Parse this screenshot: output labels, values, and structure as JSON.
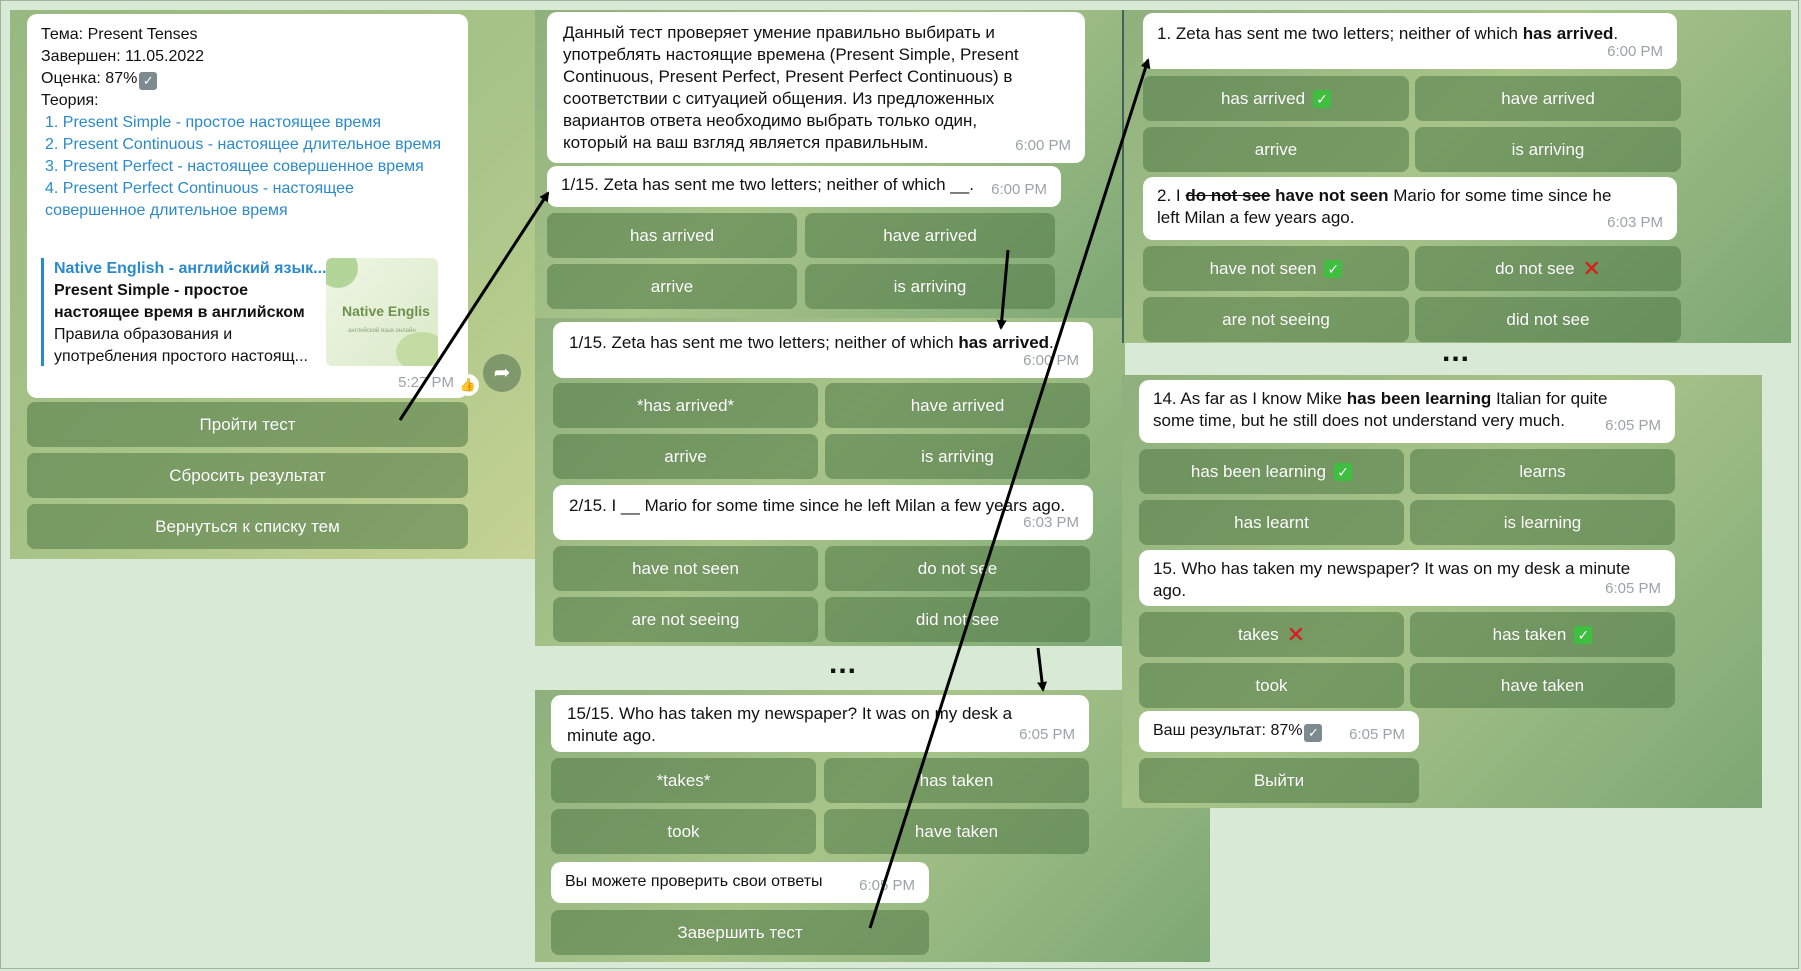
{
  "topic_card": {
    "topic": "Тема: Present Tenses",
    "completed": "Завершен: 11.05.2022",
    "grade": "Оценка: 87%",
    "theory_label": "Теория:",
    "theory_links": [
      "1. Present Simple - простое настоящее время",
      "2. Present Continuous - настоящее длительное время",
      "3. Present Perfect - настоящее совершенное время",
      "4. Present Perfect Continuous - настоящее совершенное длительное время"
    ],
    "preview": {
      "site": "Native English - английский язык...",
      "title": "Present Simple - простое настоящее время в английском",
      "desc": "Правила образования и употребления простого настоящ...",
      "thumb_text": "Native Englis",
      "thumb_sub": "английский язык онлайн"
    },
    "time": "5:27 PM",
    "buttons": [
      "Пройти тест",
      "Сбросить результат",
      "Вернуться к списку тем"
    ]
  },
  "intro": {
    "text": "Данный тест проверяет умение правильно выбирать и употреблять настоящие времена (Present Simple, Present Continuous, Present Perfect, Present Perfect Continuous) в соответствии с ситуацией общения. Из предложенных вариантов ответа необходимо выбрать только один, который на ваш взгляд является правильным.",
    "time": "6:00 PM"
  },
  "q1_unanswered": {
    "text": "1/15. Zeta has sent me two letters; neither of which __.",
    "time": "6:00 PM",
    "options": [
      "has arrived",
      "have arrived",
      "arrive",
      "is arriving"
    ]
  },
  "q1_answered": {
    "text_before": "1/15. Zeta has sent me two letters; neither of which ",
    "text_bold": "has arrived",
    "text_after": ".",
    "time": "6:00 PM",
    "options": [
      "*has arrived*",
      "have arrived",
      "arrive",
      "is arriving"
    ]
  },
  "q2_unanswered": {
    "text": "2/15. I __ Mario for some time since he left Milan a few years ago.",
    "time": "6:03 PM",
    "options": [
      "have not seen",
      "do not see",
      "are not seeing",
      "did not see"
    ]
  },
  "ellipsis": "...",
  "q15_unanswered": {
    "text": "15/15. Who has taken my newspaper? It was on my desk a minute ago.",
    "time": "6:05 PM",
    "options": [
      "*takes*",
      "has taken",
      "took",
      "have taken"
    ]
  },
  "check_msg": {
    "text": "Вы можете проверить свои ответы",
    "time": "6:05 PM"
  },
  "finish_button": "Завершить тест",
  "review_q1": {
    "text_before": "1. Zeta has sent me two letters; neither of which ",
    "text_bold": "has arrived",
    "text_after": ".",
    "time": "6:00 PM",
    "options": [
      "has arrived",
      "have arrived",
      "arrive",
      "is arriving"
    ]
  },
  "review_q2": {
    "prefix": "2. I ",
    "struck": "do not see",
    "bold": "have not seen",
    "rest": "Mario for some time since he left Milan a few years ago.",
    "time": "6:03 PM",
    "options": [
      "have not seen",
      "do not see",
      "are not seeing",
      "did not see"
    ]
  },
  "review_q14": {
    "text_before": "14. As far as I know Mike ",
    "text_bold": "has been learning",
    "text_after": " Italian for quite some time, but he still does not understand very much.",
    "time": "6:05 PM",
    "options": [
      "has been learning",
      "learns",
      "has learnt",
      "is learning"
    ]
  },
  "review_q15": {
    "text": "15. Who has taken my newspaper? It was on my desk a minute ago.",
    "time": "6:05 PM",
    "options": [
      "takes",
      "has taken",
      "took",
      "have taken"
    ]
  },
  "result": {
    "text": "Ваш результат: 87%",
    "time": "6:05 PM"
  },
  "exit_button": "Выйти",
  "colors": {
    "correct": "#3fbf3f",
    "wrong": "#e3161c",
    "link": "#2b8ac9",
    "button": "#6e9462"
  }
}
